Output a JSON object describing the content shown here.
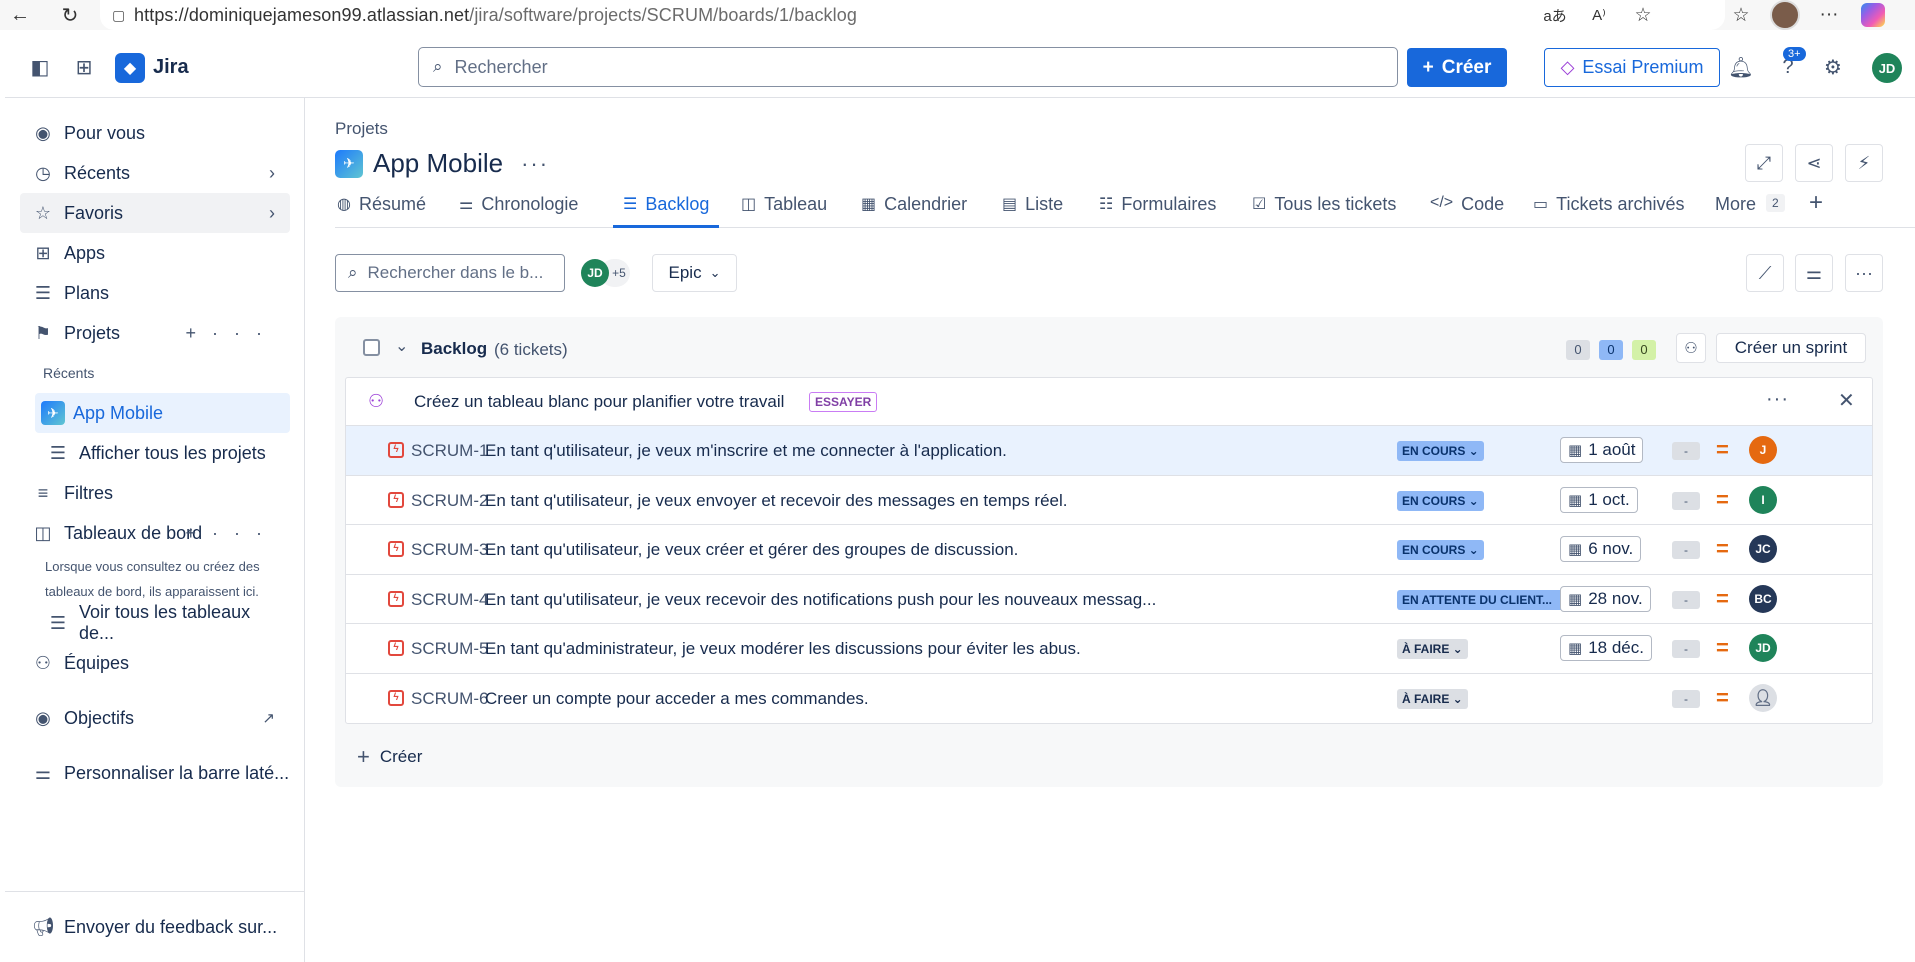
{
  "browser": {
    "url_host": "https://dominiquejameson99.atlassian.net",
    "url_path": "/jira/software/projects/SCRUM/boards/1/backlog"
  },
  "topnav": {
    "app_name": "Jira",
    "search_placeholder": "Rechercher",
    "create_label": "Créer",
    "premium_label": "Essai Premium",
    "notif_badge": "3+",
    "user_initials": "JD"
  },
  "sidebar": {
    "for_you": "Pour vous",
    "recent": "Récents",
    "favorites": "Favoris",
    "apps": "Apps",
    "plans": "Plans",
    "projects": "Projets",
    "recent_sub": "Récents",
    "app_mobile": "App Mobile",
    "all_projects": "Afficher tous les projets",
    "filters": "Filtres",
    "dashboards": "Tableaux de bord",
    "dashboards_help": "Lorsque vous consultez ou créez des tableaux de bord, ils apparaissent ici.",
    "all_dashboards": "Voir tous les tableaux de...",
    "teams": "Équipes",
    "goals": "Objectifs",
    "customize": "Personnaliser la barre laté...",
    "feedback": "Envoyer du feedback sur..."
  },
  "header": {
    "breadcrumb": "Projets",
    "project_title": "App Mobile"
  },
  "tabs": [
    {
      "label": "Résumé"
    },
    {
      "label": "Chronologie"
    },
    {
      "label": "Backlog"
    },
    {
      "label": "Tableau"
    },
    {
      "label": "Calendrier"
    },
    {
      "label": "Liste"
    },
    {
      "label": "Formulaires"
    },
    {
      "label": "Tous les tickets"
    },
    {
      "label": "Code"
    },
    {
      "label": "Tickets archivés"
    },
    {
      "label": "More",
      "count": "2"
    }
  ],
  "toolbar": {
    "search_placeholder": "Rechercher dans le b...",
    "filter_avatar": "JD",
    "filter_more": "+5",
    "epic_label": "Epic"
  },
  "backlog": {
    "title": "Backlog",
    "count": "(6 tickets)",
    "points_todo": "0",
    "points_progress": "0",
    "points_done": "0",
    "create_sprint": "Créer un sprint",
    "promo_text": "Créez un tableau blanc pour planifier votre travail",
    "promo_badge": "ESSAYER",
    "create_label": "Créer",
    "issues": [
      {
        "key": "SCRUM-1",
        "summary": "En tant q'utilisateur, je veux m'inscrire et me connecter à l'application.",
        "status": "EN COURS",
        "date": "1 août",
        "estimate": "-",
        "assignee": "J",
        "assignee_color": "#e56910"
      },
      {
        "key": "SCRUM-2",
        "summary": "En tant q'utilisateur, je veux envoyer et recevoir des messages en temps réel.",
        "status": "EN COURS",
        "date": "1 oct.",
        "estimate": "-",
        "assignee": "I",
        "assignee_color": "#1f845a"
      },
      {
        "key": "SCRUM-3",
        "summary": "En tant qu'utilisateur, je veux créer et gérer des groupes de discussion.",
        "status": "EN COURS",
        "date": "6 nov.",
        "estimate": "-",
        "assignee": "JC",
        "assignee_color": "#253858"
      },
      {
        "key": "SCRUM-4",
        "summary": "En tant qu'utilisateur, je veux recevoir des notifications push pour les nouveaux messag...",
        "status": "EN ATTENTE DU CLIENT...",
        "date": "28 nov.",
        "estimate": "-",
        "assignee": "BC",
        "assignee_color": "#253858"
      },
      {
        "key": "SCRUM-5",
        "summary": "En tant qu'administrateur, je veux modérer les discussions pour éviter les abus.",
        "status": "À FAIRE",
        "date": "18 déc.",
        "estimate": "-",
        "assignee": "JD",
        "assignee_color": "#1f845a"
      },
      {
        "key": "SCRUM-6",
        "summary": "Creer un compte pour acceder a mes commandes.",
        "status": "À FAIRE",
        "date": "",
        "estimate": "-",
        "assignee": "",
        "assignee_color": "#dcdfe4"
      }
    ]
  },
  "colors": {
    "brand_blue": "#1868db",
    "status_progress": "#8fb8f6",
    "status_todo": "#dcdfe4",
    "priority_medium": "#e56910",
    "bug_red": "#e2483d"
  }
}
